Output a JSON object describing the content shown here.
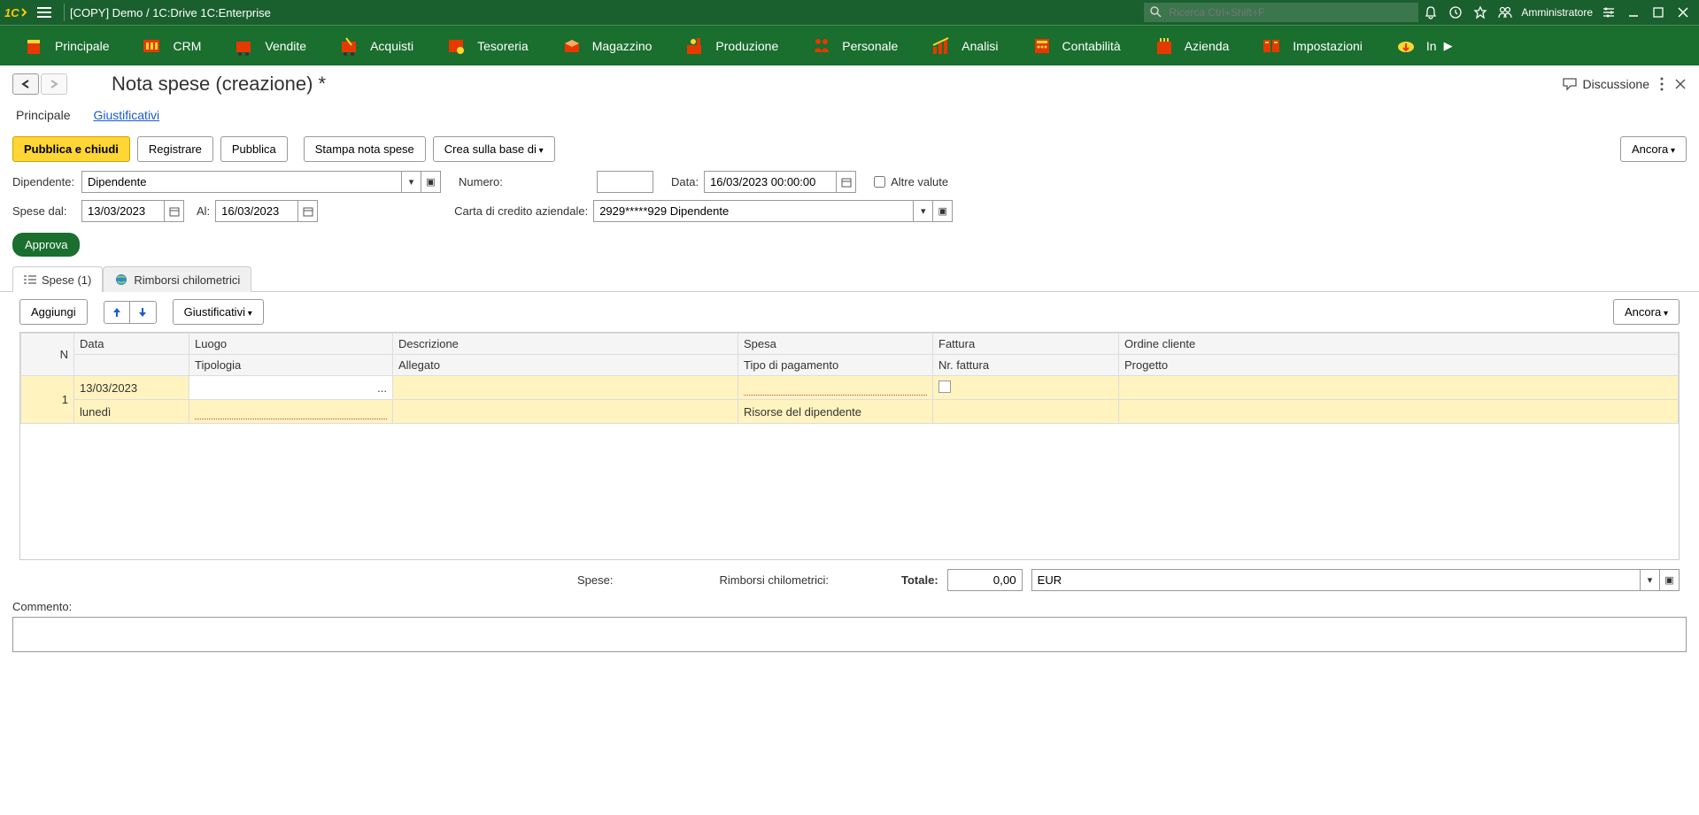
{
  "titleBar": {
    "title": "[COPY] Demo / 1C:Drive 1C:Enterprise",
    "searchPlaceholder": "Ricerca Ctrl+Shift+F",
    "user": "Amministratore"
  },
  "mainNav": [
    {
      "label": "Principale"
    },
    {
      "label": "CRM"
    },
    {
      "label": "Vendite"
    },
    {
      "label": "Acquisti"
    },
    {
      "label": "Tesoreria"
    },
    {
      "label": "Magazzino"
    },
    {
      "label": "Produzione"
    },
    {
      "label": "Personale"
    },
    {
      "label": "Analisi"
    },
    {
      "label": "Contabilità"
    },
    {
      "label": "Azienda"
    },
    {
      "label": "Impostazioni"
    },
    {
      "label": "In"
    }
  ],
  "pageTitle": "Nota spese (creazione) *",
  "discussione": "Discussione",
  "subTabs": {
    "principale": "Principale",
    "giustificativi": "Giustificativi"
  },
  "toolbar": {
    "pubblicaChiudi": "Pubblica e chiudi",
    "registrare": "Registrare",
    "pubblica": "Pubblica",
    "stampa": "Stampa nota spese",
    "creaBase": "Crea sulla base di",
    "ancora": "Ancora"
  },
  "form": {
    "dipendenteLabel": "Dipendente:",
    "dipendenteValue": "Dipendente",
    "numeroLabel": "Numero:",
    "numeroValue": "",
    "dataLabel": "Data:",
    "dataValue": "16/03/2023 00:00:00",
    "altreValute": "Altre valute",
    "speseDalLabel": "Spese dal:",
    "speseDalValue": "13/03/2023",
    "alLabel": "Al:",
    "alValue": "16/03/2023",
    "cartaLabel": "Carta di credito aziendale:",
    "cartaValue": "2929*****929 Dipendente"
  },
  "approva": "Approva",
  "mainTabs": {
    "spese": "Spese (1)",
    "rimborsi": "Rimborsi chilometrici"
  },
  "tableToolbar": {
    "aggiungi": "Aggiungi",
    "giustificativi": "Giustificativi",
    "ancora": "Ancora"
  },
  "tableHeaders": {
    "n": "N",
    "data": "Data",
    "luogo": "Luogo",
    "descrizione": "Descrizione",
    "spesa": "Spesa",
    "fattura": "Fattura",
    "ordine": "Ordine cliente",
    "tipologia": "Tipologia",
    "allegato": "Allegato",
    "tipoPag": "Tipo di pagamento",
    "nrFattura": "Nr. fattura",
    "progetto": "Progetto"
  },
  "tableRows": [
    {
      "n": "1",
      "data": "13/03/2023",
      "dataDay": "lunedì",
      "luogo": "",
      "tipologia": "",
      "descrizione": "",
      "allegato": "",
      "spesa": "",
      "tipoPag": "Risorse del dipendente",
      "fatturaCheck": false,
      "nrFattura": "",
      "ordine": "",
      "progetto": ""
    }
  ],
  "totals": {
    "speseLabel": "Spese:",
    "rimborsiLabel": "Rimborsi chilometrici:",
    "totaleLabel": "Totale:",
    "totaleValue": "0,00",
    "valuta": "EUR"
  },
  "commentoLabel": "Commento:"
}
